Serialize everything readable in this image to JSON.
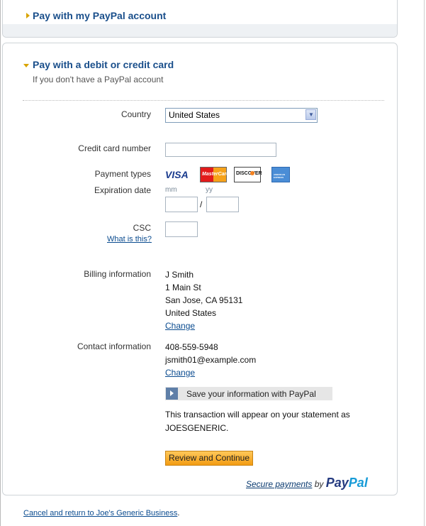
{
  "paypal_account": {
    "title": "Pay with my PayPal account"
  },
  "card_section": {
    "title": "Pay with a debit or credit card",
    "subtitle": "If you don't have a PayPal account"
  },
  "form": {
    "country_label": "Country",
    "country_value": "United States",
    "cc_number_label": "Credit card number",
    "cc_number_value": "",
    "payment_types_label": "Payment types",
    "payment_types": [
      "VISA",
      "MasterCard",
      "DISCOVER",
      "AMERICAN EXPRESS"
    ],
    "expiration_label": "Expiration date",
    "mm_label": "mm",
    "yy_label": "yy",
    "slash": "/",
    "csc_label": "CSC",
    "csc_help": "What is this?",
    "billing_label": "Billing information",
    "billing": [
      "J Smith",
      "1 Main St",
      "San Jose, CA 95131",
      "United States"
    ],
    "billing_change": "Change",
    "contact_label": "Contact information",
    "contact": [
      "408-559-5948",
      "jsmith01@example.com"
    ],
    "contact_change": "Change",
    "save_info": "Save your information with PayPal",
    "statement_line1": "This transaction will appear on your statement as",
    "statement_line2": "JOESGENERIC.",
    "review_button": "Review and Continue"
  },
  "footer": {
    "secure_payments": "Secure payments",
    "by": "by",
    "paypal_pay": "Pay",
    "paypal_pal": "Pal",
    "cancel_link": "Cancel and return to Joe's Generic Business",
    "cancel_period": "."
  },
  "colors": {
    "heading": "#1a4f8b",
    "link": "#0a4b8f",
    "button": "#f39c12",
    "accent_arrow": "#d9a400"
  }
}
